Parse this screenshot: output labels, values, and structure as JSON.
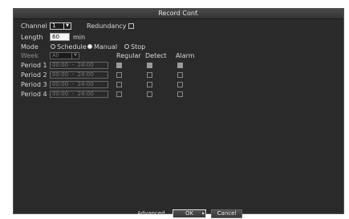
{
  "dialog": {
    "title": "Record Conf.",
    "channel_label": "Channel",
    "channel_value": "1",
    "redundancy_label": "Redundancy",
    "redundancy_checked": false,
    "length_label": "Length",
    "length_value": "60",
    "length_unit": "min",
    "mode_label": "Mode",
    "mode_options": [
      {
        "label": "Schedule",
        "selected": false
      },
      {
        "label": "Manual",
        "selected": true
      },
      {
        "label": "Stop",
        "selected": false
      }
    ],
    "week_label": "Week",
    "week_value": "All",
    "headers": {
      "regular": "Regular",
      "detect": "Detect",
      "alarm": "Alarm"
    },
    "periods": [
      {
        "label": "Period 1",
        "time": "00:00  -  24:00",
        "regular": true,
        "detect": true,
        "alarm": true
      },
      {
        "label": "Period 2",
        "time": "00:00  -  24:00",
        "regular": false,
        "detect": false,
        "alarm": false
      },
      {
        "label": "Period 3",
        "time": "00:00  -  24:00",
        "regular": false,
        "detect": false,
        "alarm": false
      },
      {
        "label": "Period 4",
        "time": "00:00  -  24:00",
        "regular": false,
        "detect": false,
        "alarm": false
      }
    ],
    "buttons": {
      "advanced": "Advanced",
      "ok": "OK",
      "cancel": "Cancel"
    }
  }
}
